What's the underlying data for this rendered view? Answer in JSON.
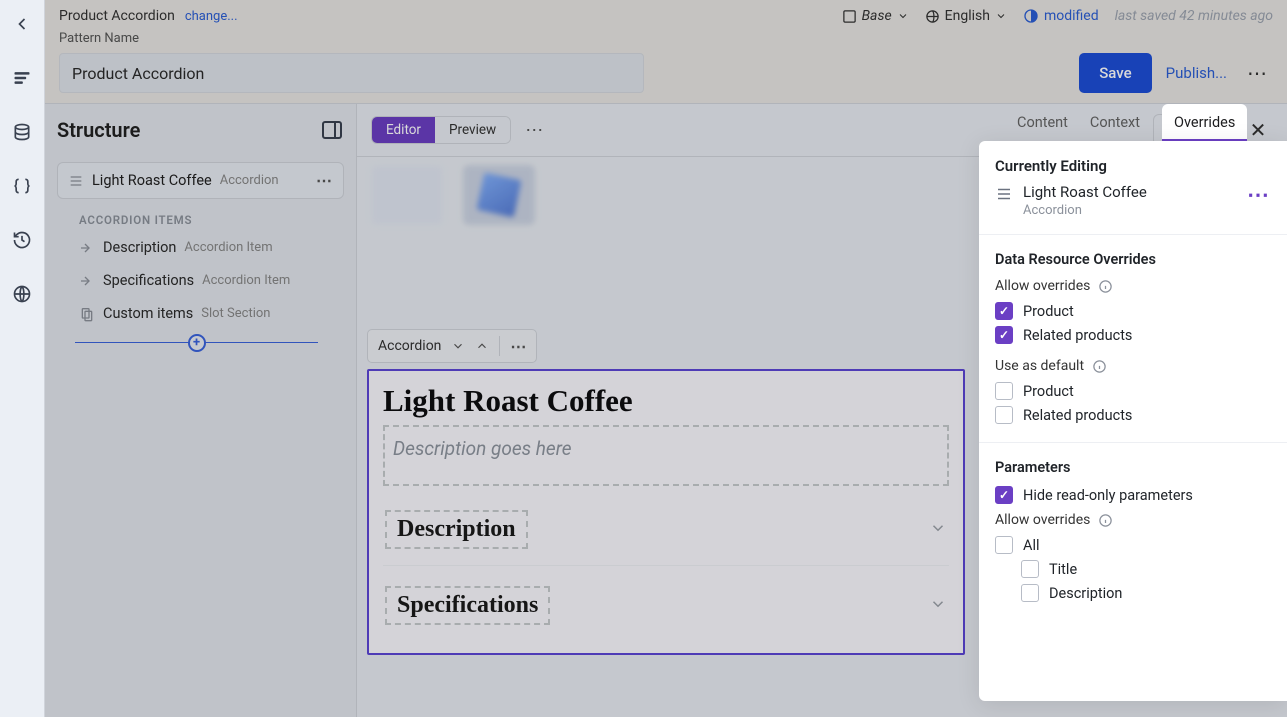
{
  "header": {
    "product_title": "Product Accordion",
    "change_label": "change...",
    "base_label": "Base",
    "lang_label": "English",
    "modified_label": "modified",
    "saved_text": "last saved 42 minutes ago",
    "pattern_label": "Pattern Name",
    "pattern_value": "Product Accordion",
    "save": "Save",
    "publish": "Publish..."
  },
  "structure": {
    "title": "Structure",
    "root_name": "Light Roast Coffee",
    "root_type": "Accordion",
    "group_label": "ACCORDION ITEMS",
    "items": [
      {
        "name": "Description",
        "type": "Accordion Item"
      },
      {
        "name": "Specifications",
        "type": "Accordion Item"
      },
      {
        "name": "Custom items",
        "type": "Slot Section",
        "slot": true
      }
    ]
  },
  "canvas": {
    "editor_tab": "Editor",
    "preview_tab": "Preview",
    "acc_label": "Accordion",
    "heading": "Light Roast Coffee",
    "description_placeholder": "Description goes here",
    "item1": "Description",
    "item2": "Specifications"
  },
  "right_tabs": {
    "content": "Content",
    "context": "Context",
    "overrides": "Overrides"
  },
  "overrides": {
    "currently_editing": "Currently Editing",
    "current_name": "Light Roast Coffee",
    "current_type": "Accordion",
    "data_resource_title": "Data Resource Overrides",
    "allow_overrides": "Allow overrides",
    "product": "Product",
    "related_products": "Related products",
    "use_as_default": "Use as default",
    "parameters_title": "Parameters",
    "hide_readonly": "Hide read-only parameters",
    "all": "All",
    "title_field": "Title",
    "description_field": "Description"
  }
}
